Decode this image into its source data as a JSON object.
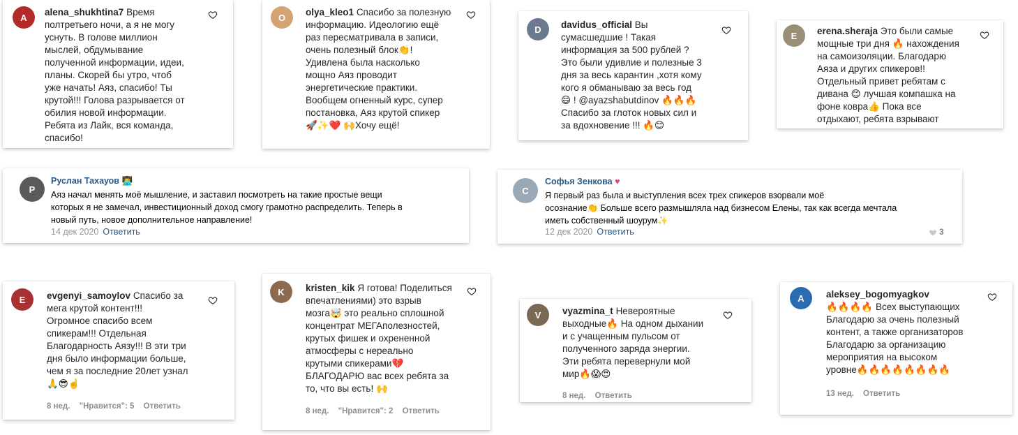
{
  "ig_comments": [
    {
      "username": "alena_shukhtina7",
      "text": "Время\nполтретьего ночи, а я не могу\nуснуть. В голове миллион\nмыслей, обдумывание\nполученной информации, идеи,\nпланы. Скорей бы утро, чтоб\nуже начать! Аяз, спасибо! Ты\nкрутой!!! Голова разрывается от\nобилия новой информации.\nРебята из Лайк, вся команда,\nспасибо!",
      "avatar_color": "#b32a2a"
    },
    {
      "username": "olya_kleo1",
      "text": "Спасибо за полезную\nинформацию. Идеологию ещё\nраз пересматривала в записи,\nочень полезный блок👏!\nУдивлена была насколько\nмощно Аяз проводит\nэнергетические практики.\nВообщем огненный курс, супер\nпостановка, Аяз крутой спикер\n🚀✨❤️ 🙌Хочу ещё!",
      "avatar_color": "#d4a373"
    },
    {
      "username": "davidus_official",
      "text": "Вы\nсумасшедшие ! Такая\nинформация за 500 рублей ?\nЭто были удивлие и полезные 3\nдня за весь карантин ,хотя кому\nкого я обманываю за весь год\n😄 ! @ayazshabutdinov 🔥🔥🔥\nСпасибо за глоток новых сил и\nза вдохновение !!! 🔥😊",
      "avatar_color": "#6b7a8f"
    },
    {
      "username": "erena.sheraja",
      "text": "Это были самые\nмощные три дня 🔥 нахождения\nна самоизоляции. Благодарю\nАяза и других спикеров!!\nОтдельный привет ребятам с\nдивана 😊 лучшая компашка на\nфоне ковра👍 Пока все\nотдыхают, ребята взрывают",
      "avatar_color": "#9a8f76"
    },
    {
      "username": "evgenyi_samoylov",
      "text": "Спасибо за\nмега крутой контент!!!\nОгромное спасибо всем\nспикерам!!! Отдельная\nБлагодарность Аязу!!! В эти три\nдня было информации больше,\nчем я за последние 20лет узнал\n🙏😎☝️",
      "avatar_color": "#a83232",
      "date": "8 нед.",
      "likes": "\"Нравится\": 5",
      "reply": "Ответить"
    },
    {
      "username": "kristen_kik",
      "text": "Я готова! Поделиться\nвпечатлениями) это взрыв\nмозга🤯 это реально сплошной\nконцентрат МЕГАполезностей,\nкрутых фишек и охрененной\nатмосферы с нереально\nкрутыми спикерами💔\nБЛАГОДАРЮ вас всех ребята за\nто, что вы есть! 🙌",
      "avatar_color": "#8c6a4f",
      "date": "8 нед.",
      "likes": "\"Нравится\": 2",
      "reply": "Ответить"
    },
    {
      "username": "vyazmina_t",
      "text": "Невероятные\nвыходные🔥 На одном дыхании\nи с учащенным пульсом от\nполученного заряда энергии.\nЭти ребята перевернули мой\nмир🔥😱😍",
      "avatar_color": "#7a6a55",
      "date": "8 нед.",
      "reply": "Ответить"
    },
    {
      "username": "aleksey_bogomyagkov",
      "text": "🔥🔥🔥🔥 Всех выступающих\nБлагодарю за очень полезный\nконтент, а также организаторов\nБлагодарю за организацию\nмероприятия на высоком\nуровне🔥🔥🔥🔥🔥🔥🔥🔥",
      "avatar_color": "#2b6cb0",
      "date": "13 нед.",
      "reply": "Ответить"
    }
  ],
  "vk_comments": [
    {
      "name": "Руслан Тахауов",
      "badge": "👨‍💻",
      "text": "Аяз начал менять моё мышление, и заставил посмотреть на такие простые вещи\nкоторых я не замечал, инвестиционный доход смогу грамотно распределить. Теперь в\nновый путь, новое дополнительное направление!",
      "date": "14 дек 2020",
      "reply": "Ответить",
      "avatar_color": "#5a5a5a"
    },
    {
      "name": "Софья Зенкова",
      "badge": "♥",
      "text": "Я первый раз была и выступления всех трех спикеров взорвали моё\nосознание👏 Больше всего размышляла над бизнесом Елены, так как всегда мечтала\nиметь собственный шоурум✨",
      "date": "12 дек 2020",
      "reply": "Ответить",
      "likes": "3",
      "avatar_color": "#9aa9b5"
    }
  ],
  "colors": {
    "ig_meta": "#8e8e8e",
    "vk_name": "#2a5885",
    "vk_heart": "#e6457a"
  }
}
